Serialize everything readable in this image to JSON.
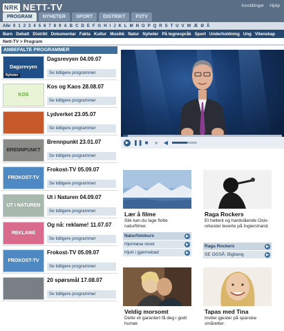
{
  "header": {
    "logo_mark": "NRK",
    "logo_text": "NETT-TV",
    "top_links": [
      "Innstillinger",
      "Hjelp"
    ],
    "tabs": [
      "PROGRAM",
      "NYHETER",
      "SPORT",
      "DISTRIKT",
      "P3TV"
    ],
    "active_tab": "PROGRAM"
  },
  "alphabet": [
    "Alle",
    "0",
    "1",
    "2",
    "3",
    "4",
    "5",
    "6",
    "7",
    "8",
    "9",
    "A",
    "B",
    "C",
    "D",
    "E",
    "F",
    "G",
    "H",
    "I",
    "J",
    "K",
    "L",
    "M",
    "N",
    "O",
    "P",
    "Q",
    "R",
    "S",
    "T",
    "U",
    "V",
    "W",
    "Æ",
    "Ø",
    "Å"
  ],
  "categories": [
    "Barn",
    "Debatt",
    "Distrikt",
    "Dokumentar",
    "Fakta",
    "Kultur",
    "Musikk",
    "Natur",
    "Nyheter",
    "På tegnespråk",
    "Sport",
    "Underholdning",
    "Ung",
    "Vitenskap"
  ],
  "breadcrumb": "Nett-TV > Program",
  "left": {
    "title": "ANBEFALTE PROGRAMMER",
    "link_label": "Se tidligere programmer",
    "items": [
      {
        "title": "Dagsrevyen 04.09.07",
        "thumb_text": "Dagsrevyen",
        "thumb_tag": "Nyheter"
      },
      {
        "title": "Kos og Kaos 28.08.07",
        "thumb_text": "KOS"
      },
      {
        "title": "Lydverket 23.05.07",
        "thumb_text": ""
      },
      {
        "title": "Brennpunkt 23.01.07",
        "thumb_text": "BRENNPUNKT"
      },
      {
        "title": "Frokost-TV 05.09.07",
        "thumb_text": "FROKOST-TV"
      },
      {
        "title": "Ut i Naturen 04.09.07",
        "thumb_text": "UT I NATUREN"
      },
      {
        "title": "Og nå: reklame! 11.07.07",
        "thumb_text": "REKLAME"
      },
      {
        "title": "Frokost-TV 05.09.07",
        "thumb_text": "FROKOST-TV"
      },
      {
        "title": "20 spørsmål 17.08.07",
        "thumb_text": ""
      }
    ]
  },
  "player": {
    "progress": 0.03,
    "volume": 0.6
  },
  "promos": [
    {
      "title": "Lær å filme",
      "desc": "Slik kan du lage flotte naturfilmer.",
      "image_text": "",
      "links": [
        {
          "label": "Naturfotokurs",
          "bold": true
        },
        {
          "label": "Hjemløse rever",
          "bold": false
        },
        {
          "label": "Hjort i gjørmebad",
          "bold": false
        }
      ]
    },
    {
      "title": "Raga Rockers",
      "desc": "Et heltent og hardslående Oslo-orkester leverte på Ingierstrand.",
      "links": [
        {
          "label": "Raga Rockers",
          "bold": true
        },
        {
          "label": "SE OGSÅ: Bigbang",
          "bold": false
        }
      ]
    },
    {
      "title": "Veldig morsomt",
      "desc": "Dette vil garantert få deg i godt humør."
    },
    {
      "title": "Tapas med Tina",
      "desc": "Inviter gjester på spanske småretter."
    }
  ],
  "colors": {
    "header": "#5a6f86",
    "category_bar": "#27486e",
    "accent": "#3e6e9b"
  }
}
